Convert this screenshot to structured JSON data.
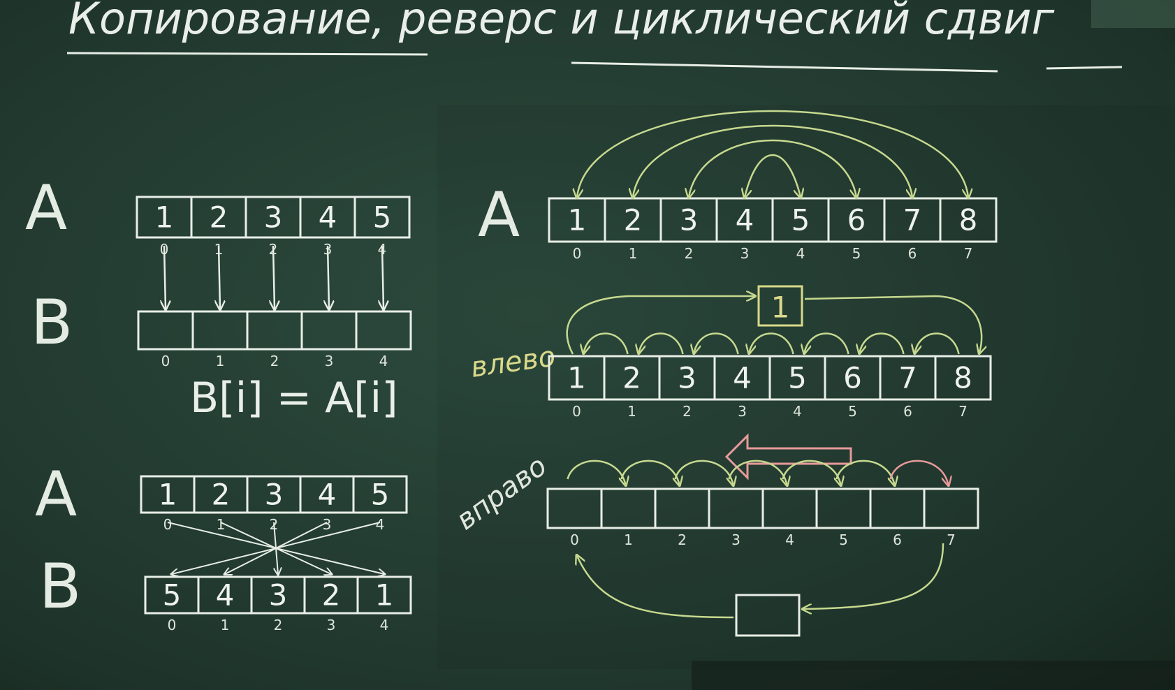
{
  "title": "Копирование, реверс и циклический сдвиг",
  "copy_section": {
    "label_a": "A",
    "label_b": "B",
    "array_a": [
      "1",
      "2",
      "3",
      "4",
      "5"
    ],
    "array_b": [
      "",
      "",
      "",
      "",
      ""
    ],
    "indices_a": [
      "0",
      "1",
      "2",
      "3",
      "4"
    ],
    "indices_b": [
      "0",
      "1",
      "2",
      "3",
      "4"
    ],
    "formula": "B[i] = A[i]"
  },
  "reverse_copy_section": {
    "label_a": "A",
    "label_b": "B",
    "array_a": [
      "1",
      "2",
      "3",
      "4",
      "5"
    ],
    "array_b": [
      "5",
      "4",
      "3",
      "2",
      "1"
    ],
    "indices_a": [
      "0",
      "1",
      "2",
      "3",
      "4"
    ],
    "indices_b": [
      "0",
      "1",
      "2",
      "3",
      "4"
    ]
  },
  "reverse_section": {
    "label_a": "A",
    "array": [
      "1",
      "2",
      "3",
      "4",
      "5",
      "6",
      "7",
      "8"
    ],
    "indices": [
      "0",
      "1",
      "2",
      "3",
      "4",
      "5",
      "6",
      "7"
    ]
  },
  "shift_left_section": {
    "label": "влево",
    "array": [
      "1",
      "2",
      "3",
      "4",
      "5",
      "6",
      "7",
      "8"
    ],
    "indices": [
      "0",
      "1",
      "2",
      "3",
      "4",
      "5",
      "6",
      "7"
    ],
    "temp_value": "1"
  },
  "shift_right_section": {
    "label": "вправо",
    "array": [
      "",
      "",
      "",
      "",
      "",
      "",
      "",
      ""
    ],
    "indices": [
      "0",
      "1",
      "2",
      "3",
      "4",
      "5",
      "6",
      "7"
    ]
  },
  "colors": {
    "chalk_white": "#e8eee6",
    "chalk_yellow": "#d9d98a",
    "chalk_green": "#c7d98f",
    "chalk_pink": "#e79a9a",
    "board": "#2a4538"
  }
}
